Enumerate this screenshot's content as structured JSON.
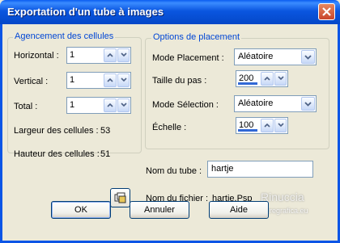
{
  "window": {
    "title": "Exportation d'un tube à images",
    "close_icon": "close-icon",
    "accent": "#0a56e0"
  },
  "cell_layout": {
    "legend": "Agencement des cellules",
    "horizontal": {
      "label": "Horizontal :",
      "value": "1"
    },
    "vertical": {
      "label": "Vertical :",
      "value": "1"
    },
    "total": {
      "label": "Total :",
      "value": "1"
    },
    "cell_width": {
      "label": "Largeur des cellules :",
      "value": "53"
    },
    "cell_height": {
      "label": "Hauteur des cellules :",
      "value": "51"
    }
  },
  "placement": {
    "legend": "Options de placement",
    "mode_placement": {
      "label": "Mode Placement :",
      "value": "Aléatoire"
    },
    "step_size": {
      "label": "Taille du pas :",
      "value": "200"
    },
    "mode_selection": {
      "label": "Mode Sélection :",
      "value": "Aléatoire"
    },
    "scale": {
      "label": "Échelle :",
      "value": "100"
    }
  },
  "tube": {
    "name_label": "Nom du tube :",
    "name_value": "hartje",
    "file_label": "Nom du fichier :",
    "file_value": "hartje.Psp",
    "browse_icon": "folder-browse-icon"
  },
  "watermark": {
    "line1": "Rinuccia",
    "line2": "www.maidiregrafica.eu"
  },
  "buttons": {
    "ok": "OK",
    "cancel": "Annuler",
    "help": "Aide"
  }
}
